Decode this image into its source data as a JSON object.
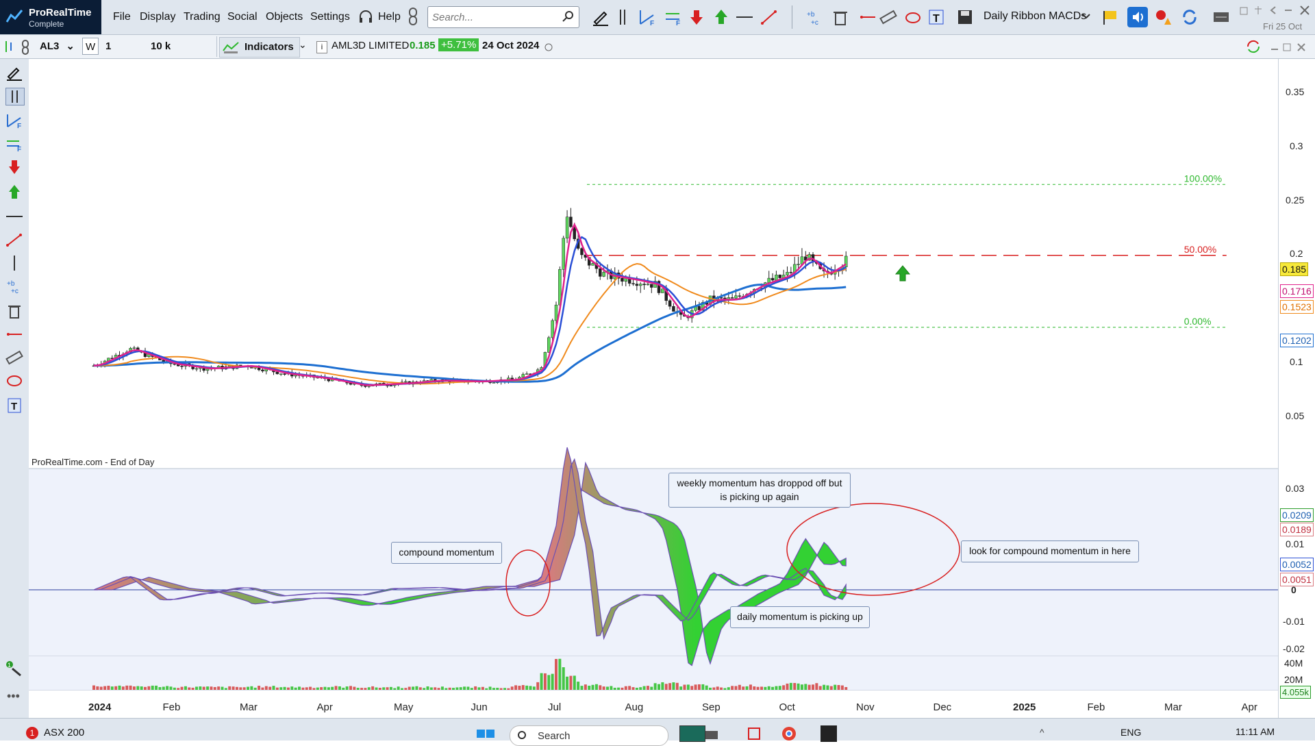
{
  "app": {
    "name": "ProRealTime",
    "edition": "Complete"
  },
  "menu": [
    "File",
    "Display",
    "Trading",
    "Social",
    "Objects",
    "Settings",
    "Help"
  ],
  "search": {
    "placeholder": "Search..."
  },
  "ribbon": {
    "label": "Daily Ribbon MACDs"
  },
  "top_date": "Fri 25 Oct",
  "toolbar": {
    "symbol": "AL3",
    "w_label": "W",
    "timeframe": "1 day",
    "units": "10 k units",
    "indicators_label": "Indicators",
    "instrument": "AML3D LIMITED",
    "price": "0.185",
    "change": "+5.71%",
    "date": "24 Oct 2024"
  },
  "colors": {
    "green": "#2db82d",
    "red": "#d23030",
    "magenta": "#e0208c",
    "blue_ma": "#2a4fd6",
    "orange_ma": "#f08a1c",
    "long_ma": "#1d6fd1",
    "macd_green": "#33d133",
    "macd_red": "#d97a80"
  },
  "chart_data": {
    "type": "line",
    "source_label": "ProRealTime.com - End of Day",
    "x_labels": [
      "2024",
      "Feb",
      "Mar",
      "Apr",
      "May",
      "Jun",
      "Jul",
      "Aug",
      "Sep",
      "Oct",
      "Nov",
      "Dec",
      "2025",
      "Feb",
      "Mar",
      "Apr"
    ],
    "price_axis_ticks": [
      "0.35",
      "0.3",
      "0.25",
      "0.2",
      "0.1",
      "0.05"
    ],
    "ylim": [
      0.0,
      0.37
    ],
    "fib_levels": [
      {
        "label": "100.00%",
        "value": 0.262
      },
      {
        "label": "50.00%",
        "value": 0.19
      },
      {
        "label": "0.00%",
        "value": 0.117
      }
    ],
    "last_price": "0.185",
    "ma_values": [
      "0.1716",
      "0.1523",
      "0.1202"
    ],
    "price_series": {
      "x": [
        "2024-01",
        "2024-01-15",
        "2024-02",
        "2024-02-15",
        "2024-03",
        "2024-03-15",
        "2024-04",
        "2024-04-15",
        "2024-05",
        "2024-05-15",
        "2024-06",
        "2024-06-15",
        "2024-06-25",
        "2024-07-01",
        "2024-07-05",
        "2024-07-10",
        "2024-07-20",
        "2024-08-01",
        "2024-08-10",
        "2024-08-20",
        "2024-09-01",
        "2024-09-10",
        "2024-09-20",
        "2024-10-01",
        "2024-10-08",
        "2024-10-15",
        "2024-10-24"
      ],
      "values": [
        0.078,
        0.095,
        0.08,
        0.075,
        0.078,
        0.07,
        0.065,
        0.058,
        0.06,
        0.063,
        0.062,
        0.064,
        0.075,
        0.14,
        0.235,
        0.19,
        0.17,
        0.165,
        0.16,
        0.125,
        0.145,
        0.145,
        0.16,
        0.17,
        0.19,
        0.17,
        0.185
      ]
    },
    "indicator_panel": {
      "ticks": [
        "0.03",
        "0.01",
        "0",
        "-0.01",
        "-0.02"
      ],
      "values": [
        "0.0209",
        "0.0189",
        "0.0052",
        "0.0051"
      ],
      "ylim": [
        -0.025,
        0.035
      ]
    },
    "volume_panel": {
      "ticks": [
        "40M",
        "20M"
      ],
      "last_volume": "4.055k"
    }
  },
  "annotations": {
    "compound": "compound momentum",
    "weekly_line1": "weekly momentum has droppod off but",
    "weekly_line2": "is picking up again",
    "look_for": "look for compound momentum in here",
    "daily": "daily momentum is picking up"
  },
  "taskbar": {
    "notification_count": "1",
    "index_label": "ASX 200",
    "search_label": "Search",
    "lang": "ENG",
    "time": "11:11 AM"
  }
}
